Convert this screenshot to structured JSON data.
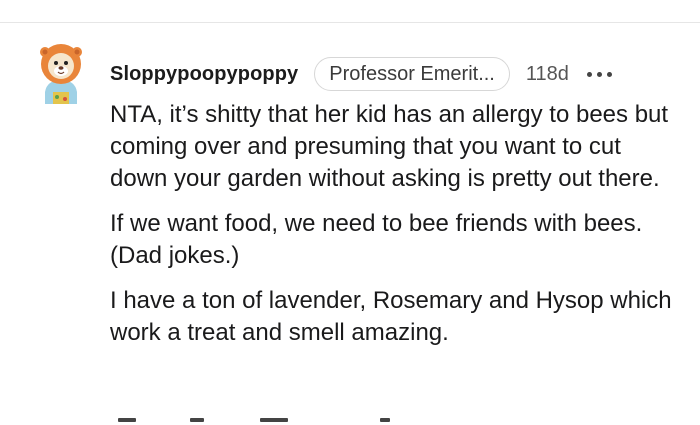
{
  "comment": {
    "username": "Sloppypoopypoppy",
    "flair": "Professor Emerit...",
    "age": "118d",
    "more_icon": "more-dots-icon",
    "avatar_icon": "user-avatar-icon",
    "paragraphs": [
      "NTA, it’s shitty that her kid has an allergy to bees but coming over and presuming that you want to cut down your garden without asking is pretty out there.",
      "If we want food, we need to bee friends with bees. (Dad jokes.)",
      "I have a ton of lavender, Rosemary and Hysop which work a treat and smell amazing."
    ]
  },
  "colors": {
    "text": "#1a1a1b",
    "meta": "#555555",
    "flair_border": "#d7d7d7",
    "divider": "#e6e6e6"
  }
}
